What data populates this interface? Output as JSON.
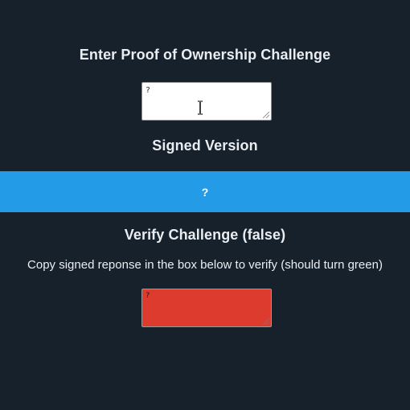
{
  "challenge": {
    "heading": "Enter Proof of Ownership Challenge",
    "input_value": "?"
  },
  "signed": {
    "heading": "Signed Version",
    "value": "?"
  },
  "verify": {
    "heading": "Verify Challenge (false)",
    "instruction": "Copy signed reponse in the box below to verify (should turn green)",
    "input_value": "?",
    "status_color": "#de3b2f"
  },
  "colors": {
    "background": "#17212b",
    "accent_bar": "#239be6"
  },
  "icons": {
    "cursor": "text-cursor-icon",
    "grip": "resize-grip-icon"
  }
}
